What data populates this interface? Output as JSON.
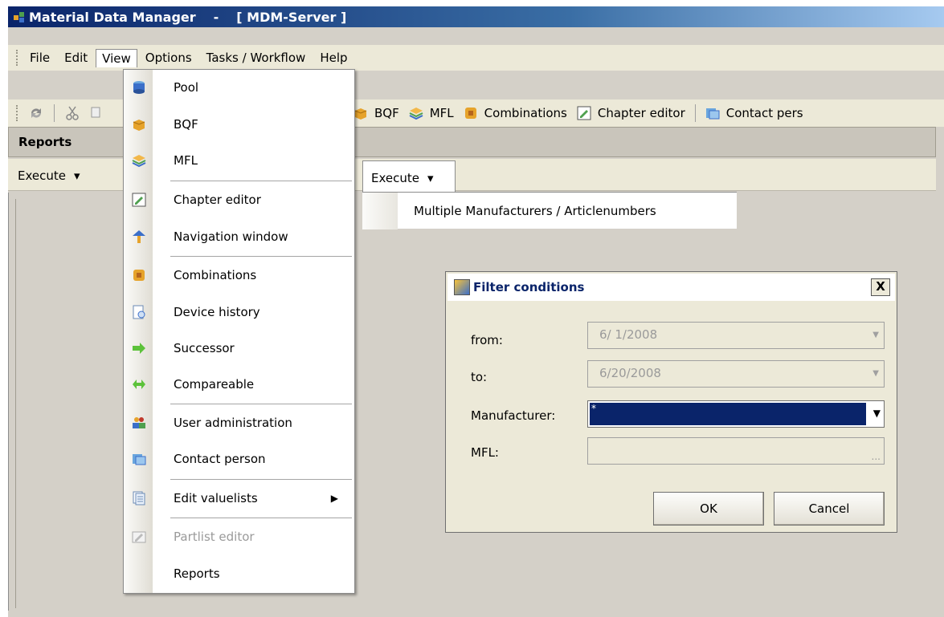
{
  "window": {
    "app_name": "Material Data Manager",
    "separator": "-",
    "server": "[ MDM-Server ]"
  },
  "menubar": {
    "items": [
      "File",
      "Edit",
      "View",
      "Options",
      "Tasks / Workflow",
      "Help"
    ]
  },
  "toolbar": {
    "buttons": [
      {
        "label": "BQF",
        "icon": "bqf-box-icon"
      },
      {
        "label": "MFL",
        "icon": "mfl-stack-icon"
      },
      {
        "label": "Combinations",
        "icon": "combinations-icon"
      },
      {
        "label": "Chapter editor",
        "icon": "chapter-editor-icon"
      },
      {
        "label": "Contact pers",
        "icon": "contact-person-icon"
      }
    ]
  },
  "reports": {
    "header": "Reports",
    "execute_label": "Execute",
    "popup_execute_label": "Execute",
    "popup_item": "Multiple Manufacturers / Articlenumbers"
  },
  "view_menu": {
    "items": [
      {
        "label": "Pool",
        "icon": "pool-icon"
      },
      {
        "label": "BQF",
        "icon": "bqf-icon"
      },
      {
        "label": "MFL",
        "icon": "mfl-icon"
      },
      {
        "label": "Chapter editor",
        "icon": "chapter-editor-icon"
      },
      {
        "label": "Navigation window",
        "icon": "navigation-icon"
      },
      {
        "label": "Combinations",
        "icon": "combinations-icon"
      },
      {
        "label": "Device history",
        "icon": "device-history-icon"
      },
      {
        "label": "Successor",
        "icon": "successor-arrow-icon"
      },
      {
        "label": "Compareable",
        "icon": "compareable-icon"
      },
      {
        "label": "User administration",
        "icon": "users-icon"
      },
      {
        "label": "Contact person",
        "icon": "contact-person-icon"
      },
      {
        "label": "Edit valuelists",
        "icon": "valuelists-icon"
      },
      {
        "label": "Partlist editor",
        "icon": "partlist-editor-icon"
      },
      {
        "label": "Reports",
        "icon": ""
      }
    ]
  },
  "dialog": {
    "title": "Filter conditions",
    "close": "X",
    "from_label": "from:",
    "from_value": "6/ 1/2008",
    "to_label": "to:",
    "to_value": "6/20/2008",
    "manufacturer_label": "Manufacturer:",
    "manufacturer_value": "*",
    "mfl_label": "MFL:",
    "mfl_value": "",
    "ok": "OK",
    "cancel": "Cancel"
  },
  "colors": {
    "title_bar": "#0a246a",
    "selection": "#0a246a",
    "window_bg": "#d4d0c8"
  }
}
